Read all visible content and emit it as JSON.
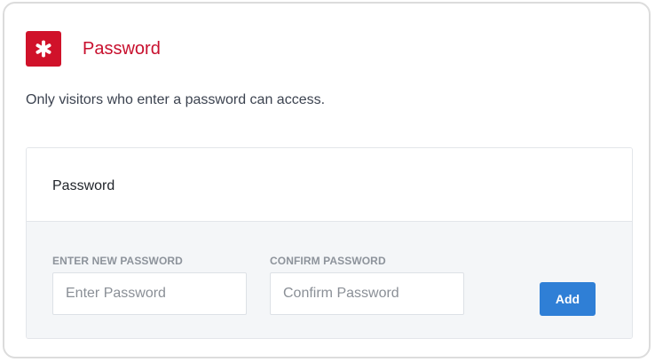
{
  "header": {
    "icon": "asterisk-icon",
    "title": "Password",
    "accent_color": "#d0122a"
  },
  "description": "Only visitors who enter a password can access.",
  "panel": {
    "title": "Password",
    "new_password": {
      "label": "ENTER NEW PASSWORD",
      "placeholder": "Enter Password",
      "value": ""
    },
    "confirm_password": {
      "label": "CONFIRM PASSWORD",
      "placeholder": "Confirm Password",
      "value": ""
    },
    "add_label": "Add",
    "button_color": "#2f7fd6"
  }
}
